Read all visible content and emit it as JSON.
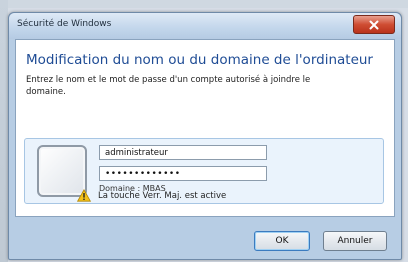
{
  "window": {
    "title": "Sécurité de Windows"
  },
  "dialog": {
    "heading": "Modification du nom ou du domaine de l'ordinateur",
    "description": "Entrez le nom et le mot de passe d'un compte autorisé à joindre le domaine."
  },
  "credentials": {
    "username_value": "administrateur",
    "password_value": "•••••••••••••",
    "domain_label": "Domaine : MBAS"
  },
  "warning": {
    "icon": "warning-icon",
    "text": "La touche Verr. Maj. est active"
  },
  "buttons": {
    "ok_label": "OK",
    "cancel_label": "Annuler"
  },
  "colors": {
    "heading": "#1f4c95",
    "close_button": "#cf4d33",
    "panel": "#eaf3fc"
  }
}
